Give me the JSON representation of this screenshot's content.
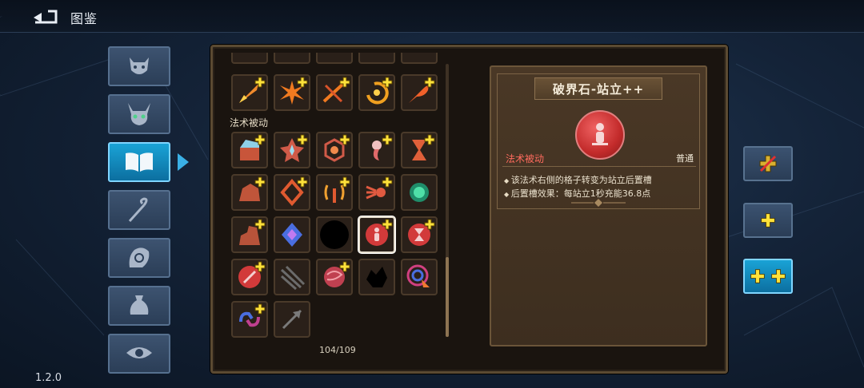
{
  "header": {
    "title": "图鉴"
  },
  "version": "1.2.0",
  "sidebar": [
    {
      "id": "monster",
      "icon": "demon-face-icon"
    },
    {
      "id": "boss",
      "icon": "horned-skull-icon"
    },
    {
      "id": "codex",
      "icon": "open-book-icon",
      "active": true
    },
    {
      "id": "staff",
      "icon": "staff-icon"
    },
    {
      "id": "relic",
      "icon": "hand-orb-icon"
    },
    {
      "id": "item",
      "icon": "pouch-icon"
    },
    {
      "id": "eye",
      "icon": "eye-icon"
    }
  ],
  "grid": {
    "section_label": "法术被动",
    "counter": "104/109"
  },
  "detail": {
    "name": "破界石-站立++",
    "type_label": "法术被动",
    "rarity": "普通",
    "lines": [
      "该法术右侧的格子转变为站立后置槽",
      "后置槽效果：每站立1秒充能36.8点"
    ]
  },
  "right_buttons": [
    {
      "id": "none",
      "icon": "no-plus-icon"
    },
    {
      "id": "plus",
      "icon": "plus-icon"
    },
    {
      "id": "double-plus",
      "icon": "double-plus-icon",
      "active": true
    }
  ],
  "colors": {
    "accent": "#1aa3d6",
    "type_red": "#ff6b5e",
    "panel": "#4a3826"
  }
}
